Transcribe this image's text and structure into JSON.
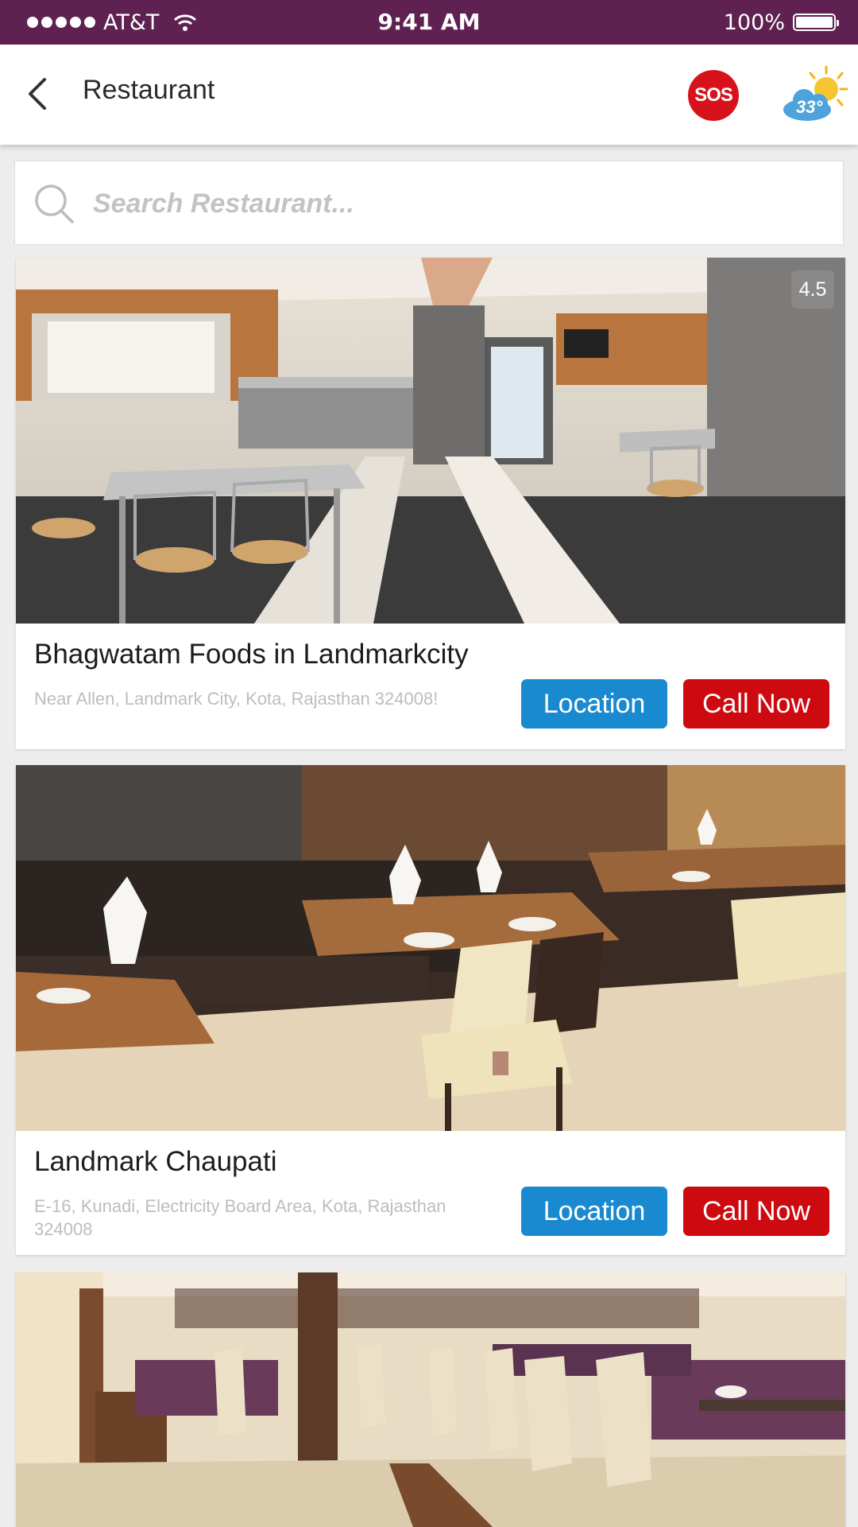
{
  "status_bar": {
    "carrier": "AT&T",
    "time": "9:41 AM",
    "battery": "100%"
  },
  "header": {
    "title": "Restaurant",
    "sos_label": "SOS",
    "weather_temp": "33°"
  },
  "search": {
    "placeholder": "Search Restaurant..."
  },
  "restaurants": [
    {
      "name": "Bhagwatam Foods in Landmarkcity",
      "address": "Near Allen, Landmark City, Kota, Rajasthan 324008!",
      "rating": "4.5",
      "location_label": "Location",
      "call_label": "Call Now"
    },
    {
      "name": "Landmark Chaupati",
      "address": "E-16, Kunadi, Electricity Board Area, Kota, Rajasthan 324008",
      "location_label": "Location",
      "call_label": "Call Now"
    },
    {
      "name": "",
      "address": ""
    }
  ],
  "colors": {
    "status_bar": "#5f2151",
    "location_button": "#1a8ad0",
    "call_button": "#cd0a0f",
    "sos": "#d7121b"
  }
}
